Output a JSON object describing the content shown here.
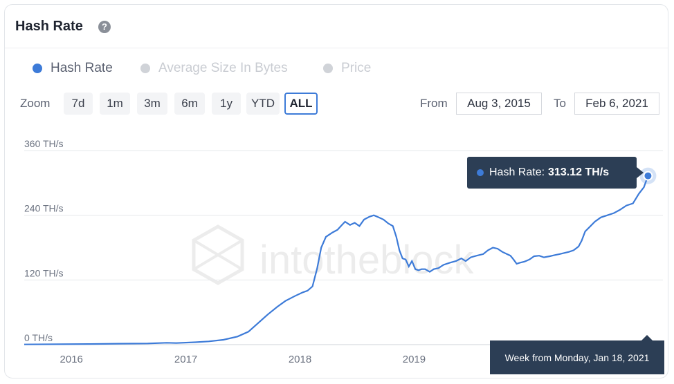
{
  "header": {
    "title": "Hash Rate",
    "help_icon": "question-circle-icon"
  },
  "legend": [
    {
      "label": "Hash Rate",
      "color": "#3d7bd8",
      "active": true
    },
    {
      "label": "Average Size In Bytes",
      "color": "#d0d3d8",
      "active": false
    },
    {
      "label": "Price",
      "color": "#d0d3d8",
      "active": false
    }
  ],
  "zoom": {
    "label": "Zoom",
    "options": [
      "7d",
      "1m",
      "3m",
      "6m",
      "1y",
      "YTD",
      "ALL"
    ],
    "selected": "ALL"
  },
  "range": {
    "from_label": "From",
    "from_value": "Aug 3, 2015",
    "to_label": "To",
    "to_value": "Feb 6, 2021"
  },
  "watermark": "intotheblock",
  "tooltip": {
    "series": "Hash Rate:",
    "value": "313.12 TH/s",
    "date": "Week from Monday, Jan 18, 2021"
  },
  "colors": {
    "line": "#3d7bd8",
    "tooltip_bg": "#2c3e55",
    "grid": "#e6e8eb"
  },
  "chart_data": {
    "type": "line",
    "y_unit": "TH/s",
    "ylim": [
      0,
      360
    ],
    "y_ticks": [
      {
        "value": 0,
        "label": "0 TH/s"
      },
      {
        "value": 120,
        "label": "120 TH/s"
      },
      {
        "value": 240,
        "label": "240 TH/s"
      },
      {
        "value": 360,
        "label": "360 TH/s"
      }
    ],
    "xlim": [
      "2015-08-03",
      "2021-02-06"
    ],
    "x_ticks": [
      {
        "date": "2016-01-01",
        "label": "2016"
      },
      {
        "date": "2017-01-01",
        "label": "2017"
      },
      {
        "date": "2018-01-01",
        "label": "2018"
      },
      {
        "date": "2019-01-01",
        "label": "2019"
      }
    ],
    "grid": true,
    "series": [
      {
        "name": "Hash Rate",
        "points": [
          [
            "2015-08-03",
            0.4
          ],
          [
            "2015-12-01",
            0.8
          ],
          [
            "2016-03-01",
            1.2
          ],
          [
            "2016-06-01",
            1.8
          ],
          [
            "2016-09-01",
            2.2
          ],
          [
            "2016-11-01",
            3.5
          ],
          [
            "2016-12-01",
            3.0
          ],
          [
            "2017-02-01",
            4.5
          ],
          [
            "2017-03-15",
            6
          ],
          [
            "2017-05-01",
            9
          ],
          [
            "2017-06-15",
            15
          ],
          [
            "2017-07-20",
            24
          ],
          [
            "2017-08-20",
            40
          ],
          [
            "2017-09-20",
            56
          ],
          [
            "2017-10-20",
            70
          ],
          [
            "2017-11-15",
            81
          ],
          [
            "2017-12-15",
            90
          ],
          [
            "2018-01-10",
            97
          ],
          [
            "2018-01-25",
            100
          ],
          [
            "2018-02-10",
            108
          ],
          [
            "2018-02-25",
            142
          ],
          [
            "2018-03-10",
            180
          ],
          [
            "2018-03-25",
            200
          ],
          [
            "2018-04-15",
            208
          ],
          [
            "2018-05-01",
            213
          ],
          [
            "2018-05-15",
            222
          ],
          [
            "2018-05-25",
            228
          ],
          [
            "2018-06-10",
            222
          ],
          [
            "2018-06-25",
            226
          ],
          [
            "2018-07-10",
            220
          ],
          [
            "2018-07-25",
            232
          ],
          [
            "2018-08-10",
            237
          ],
          [
            "2018-08-25",
            240
          ],
          [
            "2018-09-10",
            236
          ],
          [
            "2018-09-25",
            232
          ],
          [
            "2018-10-10",
            225
          ],
          [
            "2018-10-25",
            220
          ],
          [
            "2018-11-05",
            200
          ],
          [
            "2018-11-15",
            175
          ],
          [
            "2018-11-25",
            160
          ],
          [
            "2018-12-05",
            158
          ],
          [
            "2018-12-15",
            145
          ],
          [
            "2018-12-25",
            155
          ],
          [
            "2019-01-05",
            140
          ],
          [
            "2019-01-15",
            138
          ],
          [
            "2019-01-25",
            140
          ],
          [
            "2019-02-05",
            140
          ],
          [
            "2019-02-20",
            135
          ],
          [
            "2019-03-05",
            140
          ],
          [
            "2019-03-20",
            142
          ],
          [
            "2019-04-05",
            148
          ],
          [
            "2019-04-25",
            152
          ],
          [
            "2019-05-15",
            155
          ],
          [
            "2019-06-01",
            160
          ],
          [
            "2019-06-15",
            155
          ],
          [
            "2019-07-01",
            162
          ],
          [
            "2019-07-20",
            165
          ],
          [
            "2019-08-10",
            168
          ],
          [
            "2019-08-25",
            175
          ],
          [
            "2019-09-10",
            180
          ],
          [
            "2019-09-25",
            178
          ],
          [
            "2019-10-10",
            172
          ],
          [
            "2019-10-25",
            168
          ],
          [
            "2019-11-05",
            165
          ],
          [
            "2019-11-15",
            158
          ],
          [
            "2019-11-25",
            150
          ],
          [
            "2019-12-05",
            152
          ],
          [
            "2019-12-20",
            154
          ],
          [
            "2020-01-05",
            158
          ],
          [
            "2020-01-20",
            164
          ],
          [
            "2020-02-05",
            165
          ],
          [
            "2020-02-20",
            162
          ],
          [
            "2020-03-10",
            164
          ],
          [
            "2020-03-25",
            166
          ],
          [
            "2020-04-10",
            168
          ],
          [
            "2020-04-25",
            170
          ],
          [
            "2020-05-10",
            172
          ],
          [
            "2020-05-25",
            175
          ],
          [
            "2020-06-10",
            182
          ],
          [
            "2020-06-20",
            193
          ],
          [
            "2020-07-01",
            210
          ],
          [
            "2020-07-15",
            218
          ],
          [
            "2020-08-01",
            228
          ],
          [
            "2020-08-20",
            236
          ],
          [
            "2020-09-10",
            240
          ],
          [
            "2020-10-01",
            244
          ],
          [
            "2020-10-20",
            250
          ],
          [
            "2020-11-10",
            258
          ],
          [
            "2020-12-01",
            262
          ],
          [
            "2020-12-20",
            280
          ],
          [
            "2021-01-05",
            292
          ],
          [
            "2021-01-18",
            313.12
          ]
        ]
      }
    ]
  }
}
